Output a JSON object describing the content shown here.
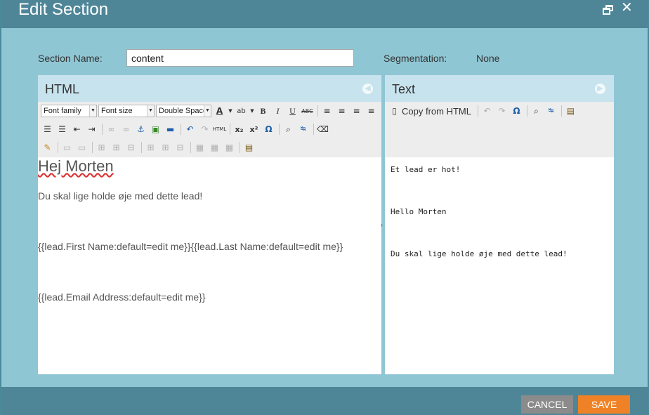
{
  "dialog": {
    "title": "Edit Section"
  },
  "form": {
    "section_name_label": "Section Name:",
    "section_name_value": "content",
    "segmentation_label": "Segmentation:",
    "segmentation_value": "None"
  },
  "html_panel": {
    "title": "HTML",
    "font_family": "Font family",
    "font_size": "Font size",
    "line_spacing": "Double Space",
    "content": {
      "heading": "Hej Morten",
      "p1": "Du skal lige holde øje med dette lead!",
      "p2": "{{lead.First Name:default=edit me}}{{lead.Last Name:default=edit me}}",
      "p3": "{{lead.Email Address:default=edit me}}"
    }
  },
  "text_panel": {
    "title": "Text",
    "copy_label": "Copy from HTML",
    "lines": {
      "l1": "Et lead er hot!",
      "l2": "Hello Morten",
      "l3": "Du skal lige holde øje med dette lead!"
    }
  },
  "footer": {
    "cancel_label": "CANCEL",
    "save_label": "SAVE"
  },
  "colors": {
    "titlebar": "#4e8698",
    "background": "#8fc6d4",
    "panel_header": "#c7e3ee",
    "save": "#ef8226",
    "cancel": "#8b8b8b"
  }
}
